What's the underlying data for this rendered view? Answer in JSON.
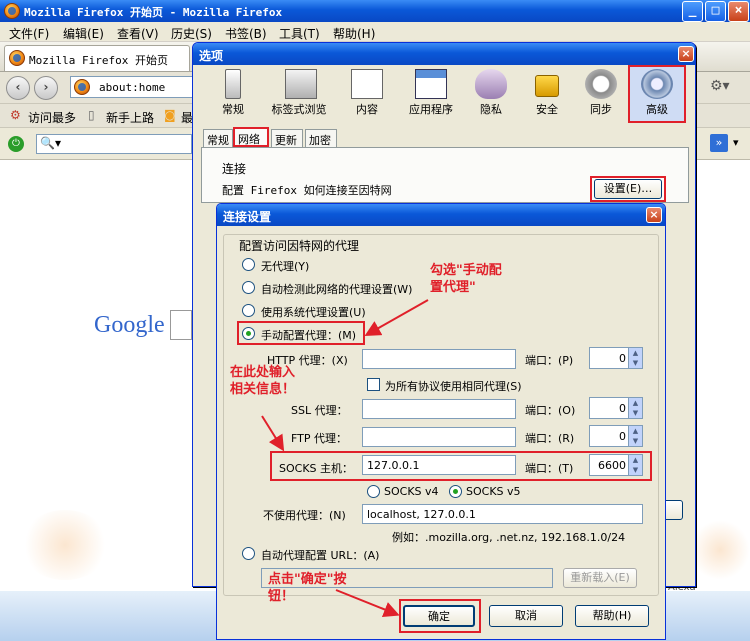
{
  "firefox": {
    "window_title": "Mozilla Firefox 开始页 - Mozilla Firefox",
    "menu": [
      "文件(F)",
      "编辑(E)",
      "查看(V)",
      "历史(S)",
      "书签(B)",
      "工具(T)",
      "帮助(H)"
    ],
    "tab_title": "Mozilla Firefox 开始页",
    "url": "about:home",
    "bookmarks": [
      "访问最多",
      "新手上路",
      "最"
    ],
    "google_logo": "Google",
    "alexa": "Alexa"
  },
  "options": {
    "title": "选项",
    "toolbar": [
      "常规",
      "标签式浏览",
      "内容",
      "应用程序",
      "隐私",
      "安全",
      "同步",
      "高级"
    ],
    "subtabs": [
      "常规",
      "网络",
      "更新",
      "加密"
    ],
    "connection_heading": "连接",
    "connection_desc": "配置 Firefox 如何连接至因特网",
    "settings_button": "设置(E)…"
  },
  "conn": {
    "title": "连接设置",
    "group_label": "配置访问因特网的代理",
    "no_proxy": "无代理(Y)",
    "auto_detect": "自动检测此网络的代理设置(W)",
    "system_proxy": "使用系统代理设置(U)",
    "manual_proxy": "手动配置代理：(M)",
    "http_label": "HTTP 代理：(X)",
    "http_value": "",
    "http_port_label": "端口：(P)",
    "http_port": "0",
    "same_proxy": "为所有协议使用相同代理(S)",
    "ssl_label": "SSL 代理：",
    "ssl_value": "",
    "ssl_port_label": "端口：(O)",
    "ssl_port": "0",
    "ftp_label": "FTP 代理：",
    "ftp_value": "",
    "ftp_port_label": "端口：(R)",
    "ftp_port": "0",
    "socks_label": "SOCKS 主机：",
    "socks_value": "127.0.0.1",
    "socks_port_label": "端口：(T)",
    "socks_port": "6600",
    "socks_v4": "SOCKS v4",
    "socks_v5": "SOCKS v5",
    "no_proxy_for_label": "不使用代理：(N)",
    "no_proxy_for_value": "localhost, 127.0.0.1",
    "example": "例如：.mozilla.org, .net.nz, 192.168.1.0/24",
    "auto_config": "自动代理配置 URL：(A)",
    "auto_config_url": "",
    "reload": "重新载入(E)",
    "ok": "确定",
    "cancel": "取消",
    "help": "帮助(H)"
  },
  "annotations": {
    "check_manual": "勾选\"手动配置代理\"",
    "input_here": "在此处输入相关信息！",
    "click_ok": "点击\"确定\"按钮！"
  },
  "colors": {
    "annotation_red": "#e0202a",
    "title_blue": "#0a58d8",
    "dialog_bg": "#ece9d8"
  }
}
